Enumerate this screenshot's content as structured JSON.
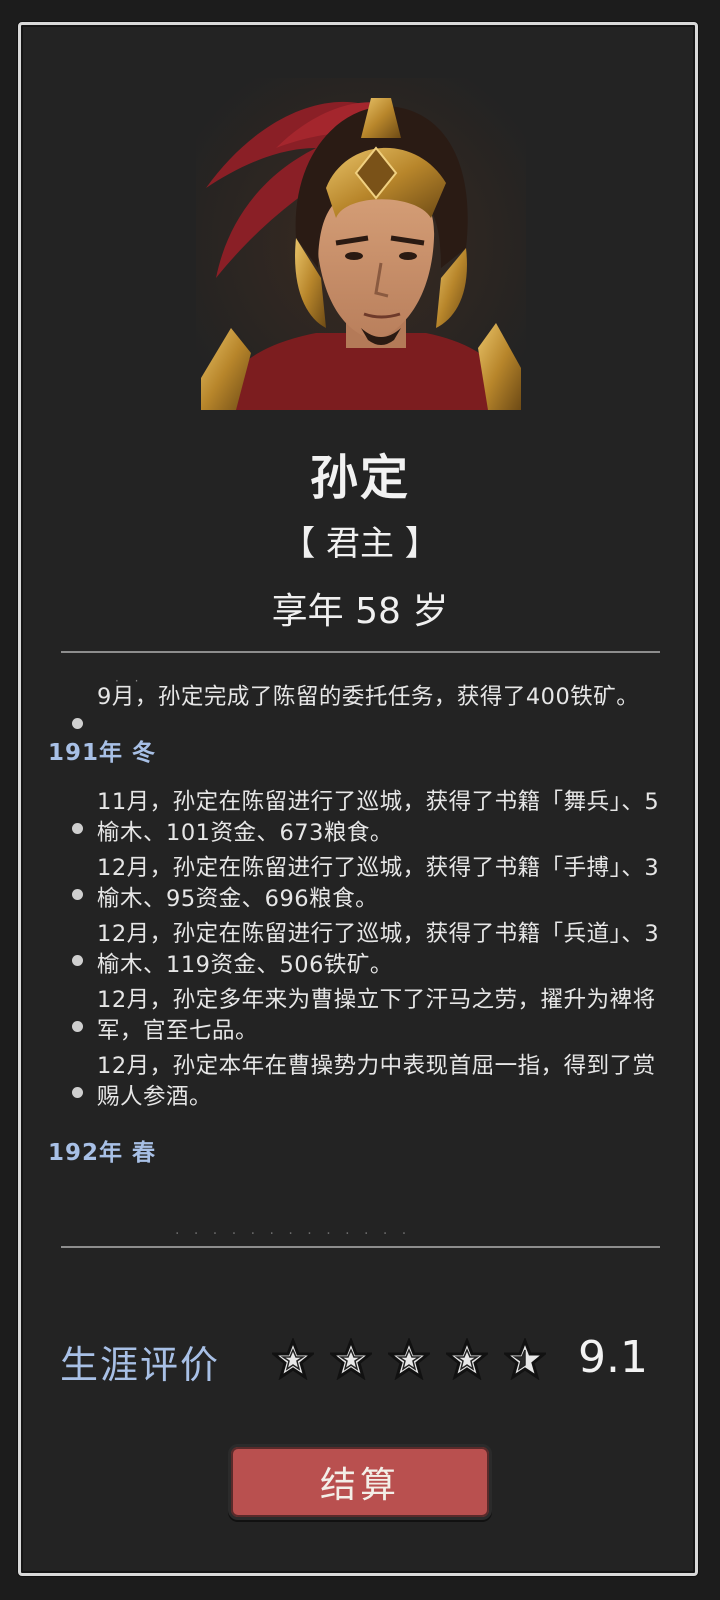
{
  "character": {
    "name": "孙定",
    "role": "【 君主 】",
    "age": "享年 58 岁"
  },
  "log": {
    "first_entry": "9月，孙定完成了陈留的委托任务，获得了400铁矿。",
    "sections": [
      {
        "season": "191年 冬",
        "entries": [
          "11月，孙定在陈留进行了巡城，获得了书籍「舞兵」、5榆木、101资金、673粮食。",
          "12月，孙定在陈留进行了巡城，获得了书籍「手搏」、3榆木、95资金、696粮食。",
          "12月，孙定在陈留进行了巡城，获得了书籍「兵道」、3榆木、119资金、506铁矿。",
          "12月，孙定多年来为曹操立下了汗马之劳，擢升为裨将军，官至七品。",
          "12月，孙定本年在曹操势力中表现首屈一指，得到了赏赐人参酒。"
        ]
      },
      {
        "season": "192年 春",
        "entries": []
      }
    ]
  },
  "career": {
    "label": "生涯评价",
    "stars_filled": 4,
    "stars_total": 5,
    "score": "9.1"
  },
  "actions": {
    "settle_label": "结算"
  },
  "colors": {
    "accent_blue": "#a8c0e6",
    "button_red": "#b9504f",
    "panel_bg": "#232323"
  }
}
